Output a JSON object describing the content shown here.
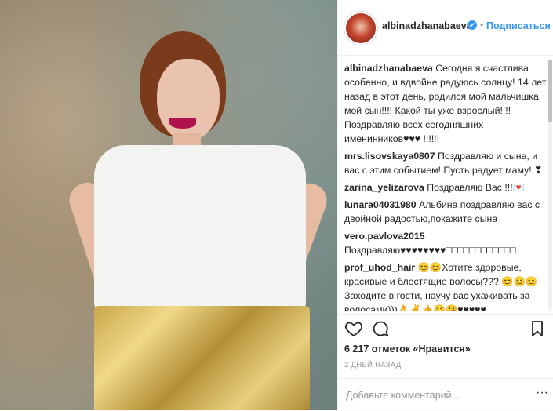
{
  "header": {
    "username": "albinadzhanabaeva",
    "verified_mark": "✔",
    "separator": "•",
    "follow_label": "Подписаться"
  },
  "comments": [
    {
      "user": "albinadzhanabaeva",
      "text": "Сегодня я счастлива особенно, и вдвойне радуюсь солнцу! 14 лет назад в этот день, родился мой мальчишка, мой сын!!!! Какой ты уже взрослый!!!! Поздравляю всех сегодняшних именинников♥♥♥ !!!!!!"
    },
    {
      "user": "mrs.lisovskaya0807",
      "text": "Поздравляю и сына, и вас с этим событием! Пусть радует маму! ❣"
    },
    {
      "user": "zarina_yelizarova",
      "text": "Поздравляю Вас !!!💌"
    },
    {
      "user": "lunara04031980",
      "text": "Альбина поздравляю вас с двойной радостью,покажите сына"
    },
    {
      "user": "vero.pavlova2015",
      "text": "Поздравляю♥♥♥♥♥♥♥♥□□□□□□□□□□□□"
    },
    {
      "user": "prof_uhod_hair",
      "text": "😊😊Хотите здоровые, красивые и блестящие волосы??? 😊😊😊 Заходите в гости, научу вас ухаживать за волосами)))👌✌👍😊😘♥♥♥♥♥"
    }
  ],
  "actions": {
    "like_icon": "heart-outline",
    "comment_icon": "speech-bubble",
    "save_icon": "bookmark-outline"
  },
  "likes_text": "6 217 отметок «Нравится»",
  "time_text": "2 ДНЕЙ НАЗАД",
  "add_comment": {
    "placeholder": "Добавьте комментарий...",
    "more_label": "···"
  }
}
